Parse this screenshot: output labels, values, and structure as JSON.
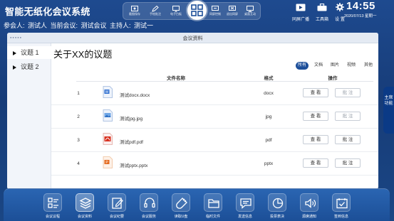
{
  "app": {
    "title": "智能无纸化会议系统"
  },
  "meeting_info": "参会人: 测试人 当前会议: 测试会议 主持人: 测试一",
  "top_tools": [
    {
      "label": "截图保存",
      "icon": "screenshot-icon"
    },
    {
      "label": "手绘批注",
      "icon": "pen-icon"
    },
    {
      "label": "电子白板",
      "icon": "whiteboard-icon"
    },
    {
      "label": "同屏控制",
      "icon": "screen-sync-icon"
    },
    {
      "label": "退出同屏",
      "icon": "exit-sync-icon"
    },
    {
      "label": "桌面互动",
      "icon": "desktop-icon"
    }
  ],
  "qr_icon": "qr-code-icon",
  "header_right": [
    {
      "label": "同屏广播",
      "icon": "broadcast-icon"
    },
    {
      "label": "工具箱",
      "icon": "toolbox-icon"
    },
    {
      "label": "设 置",
      "icon": "gear-icon"
    }
  ],
  "clock": {
    "time": "14:55",
    "date": "2020/07/13 星期一"
  },
  "panel": {
    "title": "会议资料"
  },
  "agenda": [
    {
      "label": "议题 1",
      "active": true
    },
    {
      "label": "议题 2",
      "active": false
    }
  ],
  "main": {
    "title": "关于XX的议题",
    "filters": [
      {
        "label": "所有",
        "active": true
      },
      {
        "label": "文档",
        "active": false
      },
      {
        "label": "图片",
        "active": false
      },
      {
        "label": "视频",
        "active": false
      },
      {
        "label": "其他",
        "active": false
      }
    ],
    "columns": {
      "name": "文件名称",
      "format": "格式",
      "action": "操作"
    },
    "view_label": "查 看",
    "annotate_label": "批 注",
    "files": [
      {
        "no": "1",
        "name": "测试docx.docx",
        "format": "docx",
        "icon": "word-file-icon",
        "annotate_enabled": false
      },
      {
        "no": "2",
        "name": "测试jpg.jpg",
        "format": "jpg",
        "icon": "image-file-icon",
        "annotate_enabled": false
      },
      {
        "no": "3",
        "name": "测试pdf.pdf",
        "format": "pdf",
        "icon": "pdf-file-icon",
        "annotate_enabled": true
      },
      {
        "no": "4",
        "name": "测试pptx.pptx",
        "format": "pptx",
        "icon": "ppt-file-icon",
        "annotate_enabled": true
      }
    ]
  },
  "side_tab": "主席功能",
  "dock": [
    {
      "label": "会议议程",
      "icon": "agenda-icon",
      "active": false
    },
    {
      "label": "会议资料",
      "icon": "documents-icon",
      "active": true
    },
    {
      "label": "会议纪要",
      "icon": "minutes-icon",
      "active": false
    },
    {
      "label": "会议服务",
      "icon": "headset-icon",
      "active": false
    },
    {
      "label": "读取U盘",
      "icon": "usb-icon",
      "active": false
    },
    {
      "label": "临时文件",
      "icon": "folder-icon",
      "active": false
    },
    {
      "label": "发送信息",
      "icon": "message-icon",
      "active": false
    },
    {
      "label": "投票表决",
      "icon": "vote-icon",
      "active": false
    },
    {
      "label": "Ci席通知",
      "icon": "notice-icon",
      "active": false
    },
    {
      "label": "签到信息",
      "icon": "signin-icon",
      "active": false
    }
  ],
  "colors": {
    "background": "#1a3f7e",
    "accent": "#1d4f9a",
    "panel": "#ffffff",
    "pdf": "#d8301f",
    "ppt": "#e46a1f",
    "word": "#2f6fd0"
  }
}
